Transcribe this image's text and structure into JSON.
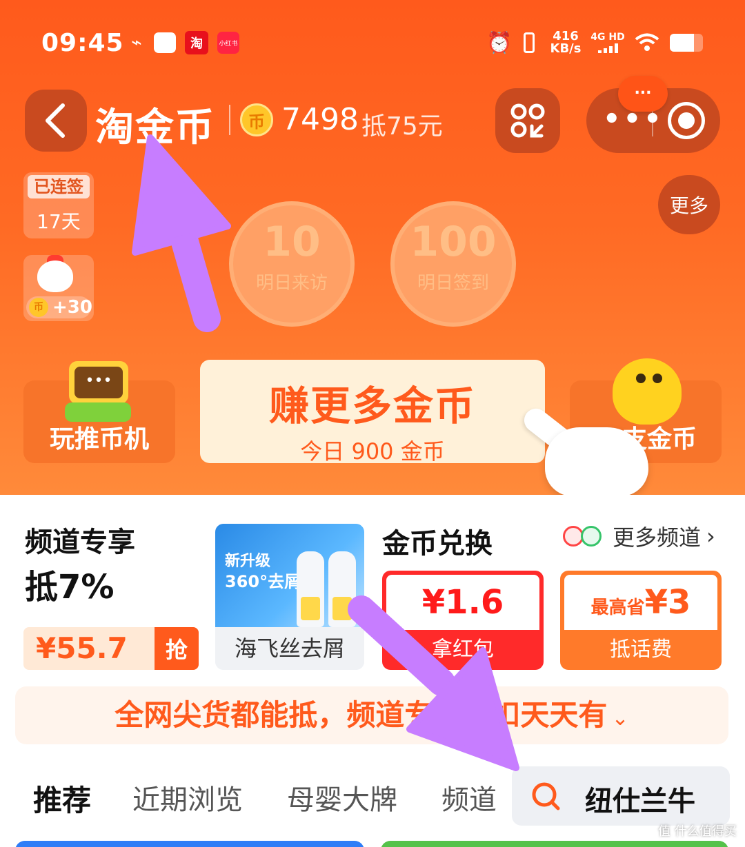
{
  "status_bar": {
    "time": "09:45",
    "taobao_badge": "淘",
    "xhs_badge": "小红书",
    "speed_value": "416",
    "speed_unit": "KB/s",
    "network": "4G HD",
    "battery_level": 0.72
  },
  "header": {
    "title": "淘金币",
    "coin_symbol": "币",
    "coin_count": "7498",
    "coin_worth": "抵75元",
    "notification": "..."
  },
  "badges": {
    "streak_label": "已连签",
    "streak_days": "17天",
    "reward_coin": "币",
    "reward": "+30"
  },
  "more_button": "更多",
  "bubbles": [
    {
      "num": "10",
      "cap": "明日来访"
    },
    {
      "num": "100",
      "cap": "明日签到"
    }
  ],
  "actions": {
    "left_label": "玩推币机",
    "earn_title": "赚更多金币",
    "earn_sub": "今日 900 金币",
    "right_label": "支金币"
  },
  "channel": {
    "title": "频道专享",
    "discount": "抵7%",
    "price": "¥55.7",
    "grab": "抢",
    "product_name": "海飞丝去屑",
    "product_line1": "新升级",
    "product_line2": "360°去屑"
  },
  "exchange": {
    "title": "金币兑换",
    "more_channels": "更多频道",
    "coupon1_amount": "¥1.6",
    "coupon1_label": "拿红包",
    "coupon2_prefix": "最高省",
    "coupon2_amount": "¥3",
    "coupon2_label": "抵话费"
  },
  "banner": {
    "text": "全网尖货都能抵，频道专享折扣天天有",
    "chevron": "⌄"
  },
  "tabs": [
    "推荐",
    "近期浏览",
    "母婴大牌",
    "频道"
  ],
  "search": {
    "query": "纽仕兰牛"
  },
  "watermark": "值 什么值得买",
  "colors": {
    "brand_orange": "#ff5a1c",
    "annotation_purple": "#c77dff"
  }
}
